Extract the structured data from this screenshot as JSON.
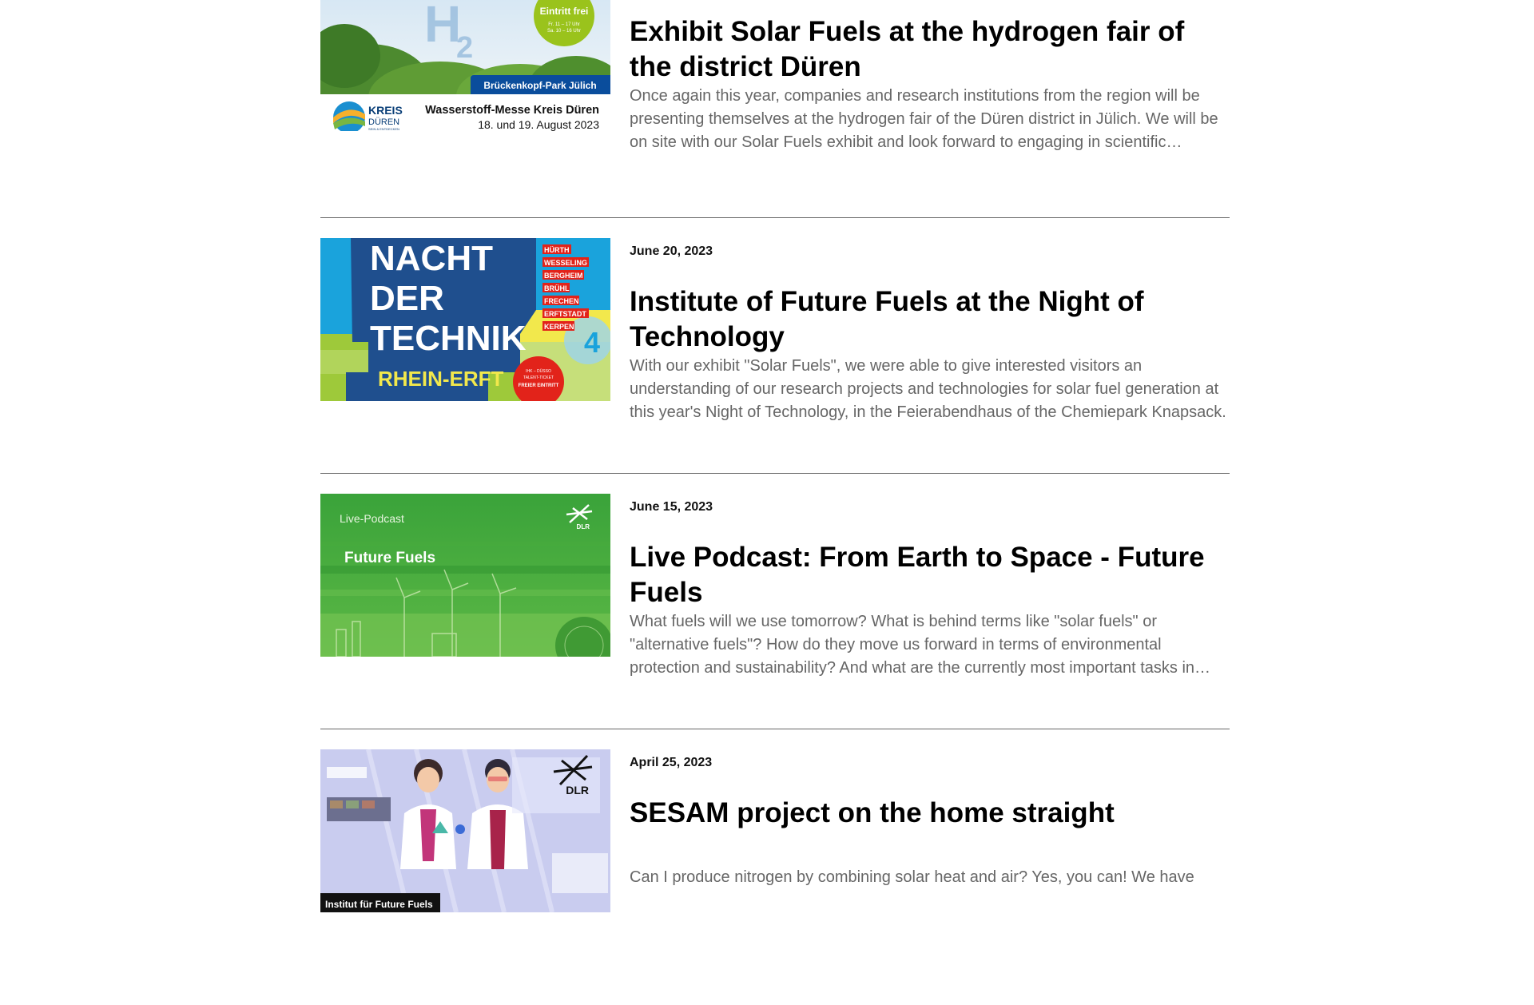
{
  "items": [
    {
      "date": "",
      "title": "Exhibit Solar Fuels at the hydrogen fair of the district Düren",
      "excerpt": "Once again this year, companies and research institutions from the region will be presenting themselves at the hydrogen fair of the Düren district in Jülich. We will be on site with our Solar Fuels exhibit and look forward to engaging in scientific exchange with visitors.",
      "image": {
        "h2": "H",
        "h2_sub": "2",
        "badge_title": "Eintritt frei",
        "badge_line1": "Fr. 11 – 17 Uhr",
        "badge_line2": "Sa. 10 – 16 Uhr",
        "banner": "Brückenkopf-Park Jülich",
        "logo_main": "KREIS",
        "logo_sub": "DÜREN",
        "logo_tag": "SEIN & ENTDECKEN",
        "event": "Wasserstoff-Messe Kreis Düren",
        "event_dates": "18. und 19. August 2023"
      }
    },
    {
      "date": "June 20, 2023",
      "title": "Institute of Future Fuels at the Night of Technology",
      "excerpt": "With our exhibit \"Solar Fuels\", we were able to give interested visitors an understanding of our research projects and technologies for solar fuel generation at this year's Night of Technology, in the Feierabendhaus of the Chemiepark Knapsack.",
      "image": {
        "line1": "NACHT",
        "line2": "DER",
        "line3": "TECHNIK",
        "region": "RHEIN-ERFT",
        "number": "4",
        "towns": [
          "HÜRTH",
          "WESSELING",
          "BERGHEIM",
          "BRÜHL",
          "FRECHEN",
          "ERFTSTADT",
          "KERPEN"
        ],
        "stamp_line1": "IHK – DÜSSO",
        "stamp_line2": "TALENT-TICKET",
        "stamp_line3": "FREIER EINTRITT"
      }
    },
    {
      "date": "June 15, 2023",
      "title": "Live Podcast: From Earth to Space - Future Fuels",
      "excerpt": "What fuels will we use tomorrow? What is behind terms like \"solar fuels\" or \"alternative fuels\"? How do they move us forward in terms of environmental protection and sustainability? And what are the currently most important tasks in research?",
      "image": {
        "kicker": "Live-Podcast",
        "headline": "Future Fuels",
        "logo": "DLR"
      }
    },
    {
      "date": "April 25, 2023",
      "title": "SESAM project on the home straight",
      "excerpt": "Can I produce nitrogen by combining solar heat and air? Yes, you can! We have",
      "image": {
        "logo": "DLR",
        "caption": "Institut für Future Fuels"
      }
    }
  ],
  "colors": {
    "title": "#000000",
    "excerpt": "#666666",
    "divider": "#666666",
    "ndt_blue": "#1aa3dc",
    "ndt_green": "#9ec93a",
    "podcast_green": "#3fa535",
    "badge_green": "#9ac31c",
    "banner_blue": "#0a4d9c"
  }
}
